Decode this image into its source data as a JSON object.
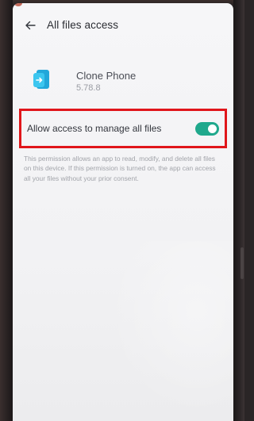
{
  "header": {
    "back_icon": "back-arrow-icon",
    "title": "All files access"
  },
  "app": {
    "icon": "clone-phone-app-icon",
    "name": "Clone Phone",
    "version": "5.78.8"
  },
  "permission": {
    "label": "Allow access to manage all files",
    "enabled": true,
    "description": "This permission allows an app to read, modify, and delete all files on this device. If this permission is turned on, the app can access all your files without your prior consent."
  },
  "colors": {
    "switch_on": "#1fa88c",
    "highlight_border": "#e0161b",
    "app_icon": "#29b6e8"
  }
}
